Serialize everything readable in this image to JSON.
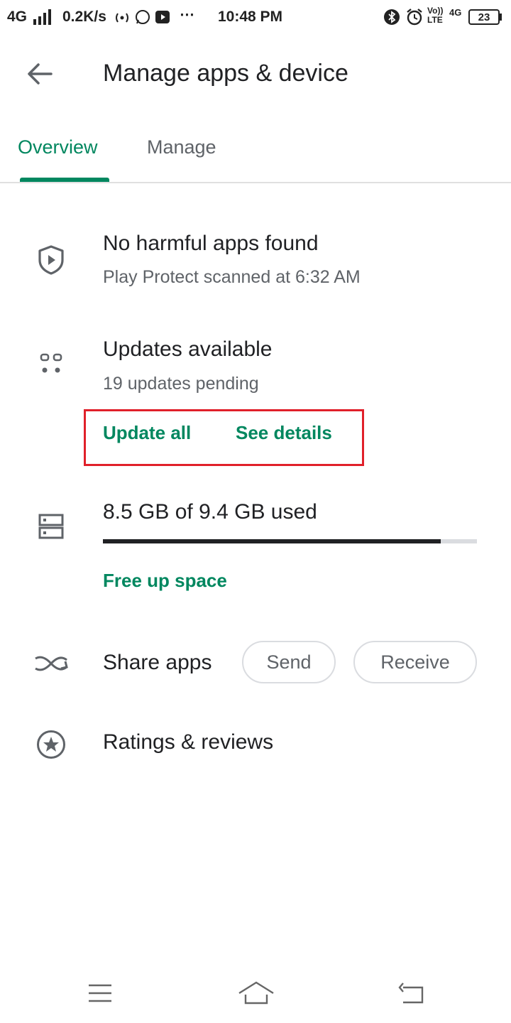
{
  "status_bar": {
    "network": "4G",
    "speed": "0.2K/s",
    "more": "⋯",
    "time": "10:48 PM",
    "volte_top": "Vo))",
    "volte_bottom": "LTE",
    "net_type": "4G",
    "battery": "23"
  },
  "app_bar": {
    "back_icon": "arrow-back-icon",
    "title": "Manage apps & device"
  },
  "tabs": [
    {
      "label": "Overview",
      "selected": true
    },
    {
      "label": "Manage",
      "selected": false
    }
  ],
  "protect": {
    "icon": "shield-play-icon",
    "title": "No harmful apps found",
    "subtitle": "Play Protect scanned at 6:32 AM"
  },
  "updates": {
    "icon": "apps-dots-icon",
    "title": "Updates available",
    "subtitle": "19 updates pending",
    "update_all": "Update all",
    "see_details": "See details"
  },
  "storage": {
    "icon": "storage-icon",
    "title": "8.5 GB of 9.4 GB used",
    "used_fraction": 0.904,
    "free_up": "Free up space"
  },
  "share": {
    "icon": "share-apps-icon",
    "title": "Share apps",
    "send": "Send",
    "receive": "Receive"
  },
  "ratings": {
    "icon": "star-circle-icon",
    "title": "Ratings & reviews"
  },
  "colors": {
    "accent": "#01875f",
    "highlight": "#e0202a",
    "text_primary": "#202124",
    "text_secondary": "#5f6368"
  },
  "nav_bar": {
    "icons": [
      "menu-icon",
      "home-icon",
      "back-nav-icon"
    ]
  }
}
